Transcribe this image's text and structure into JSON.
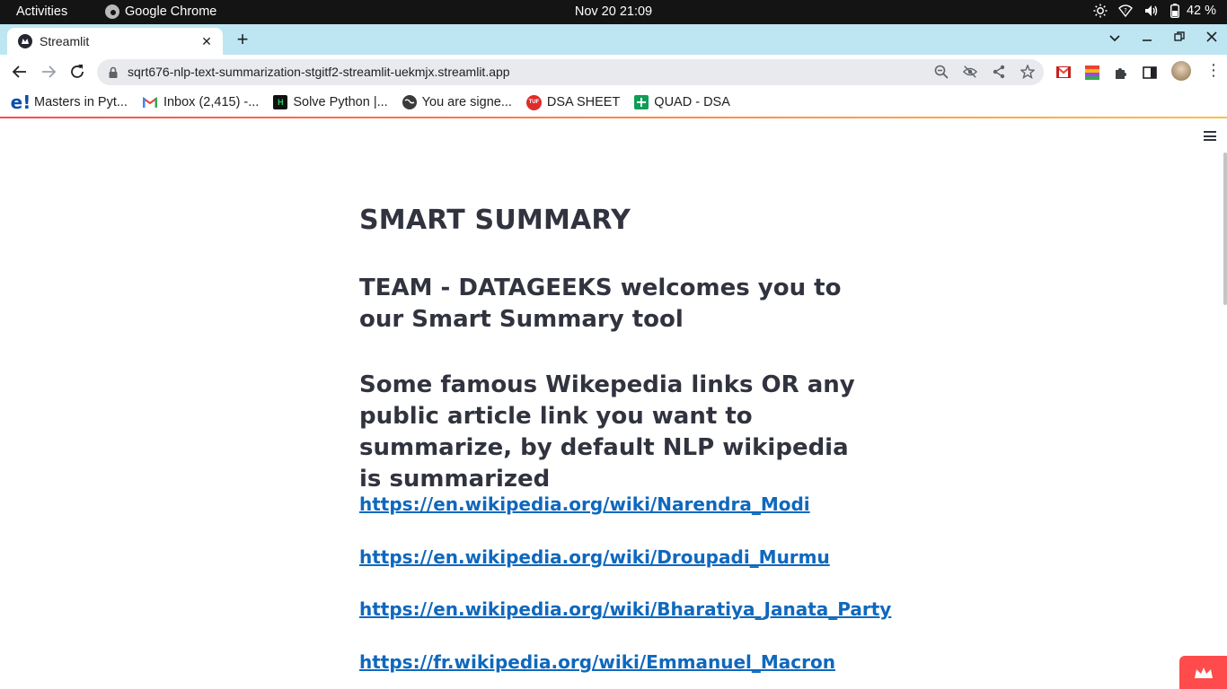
{
  "system_bar": {
    "activities": "Activities",
    "app_name": "Google Chrome",
    "clock": "Nov 20  21:09",
    "battery": "42 %"
  },
  "browser": {
    "tab_title": "Streamlit",
    "url": "sqrt676-nlp-text-summarization-stgitf2-streamlit-uekmjx.streamlit.app"
  },
  "bookmarks": [
    {
      "label": "Masters in Pyt...",
      "icon": "edureka-icon"
    },
    {
      "label": "Inbox (2,415) -...",
      "icon": "gmail-icon"
    },
    {
      "label": "Solve Python |...",
      "icon": "hackerrank-icon"
    },
    {
      "label": "You are signe...",
      "icon": "globe-icon"
    },
    {
      "label": "DSA SHEET",
      "icon": "tuf-icon"
    },
    {
      "label": "QUAD - DSA",
      "icon": "sheets-icon"
    }
  ],
  "app": {
    "title": "SMART SUMMARY",
    "subtitle": "TEAM - DATAGEEKS welcomes you to our Smart Summary tool",
    "intro": "Some famous Wikepedia links OR any public article link you want to summarize, by default NLP wikipedia is summarized",
    "links": [
      "https://en.wikipedia.org/wiki/Narendra_Modi",
      "https://en.wikipedia.org/wiki/Droupadi_Murmu",
      "https://en.wikipedia.org/wiki/Bharatiya_Janata_Party",
      "https://fr.wikipedia.org/wiki/Emmanuel_Macron"
    ]
  },
  "colors": {
    "streamlit_red": "#ff4b4b",
    "link_blue": "#0f68bd",
    "text": "#31333f",
    "tab_strip": "#bde6f2"
  }
}
